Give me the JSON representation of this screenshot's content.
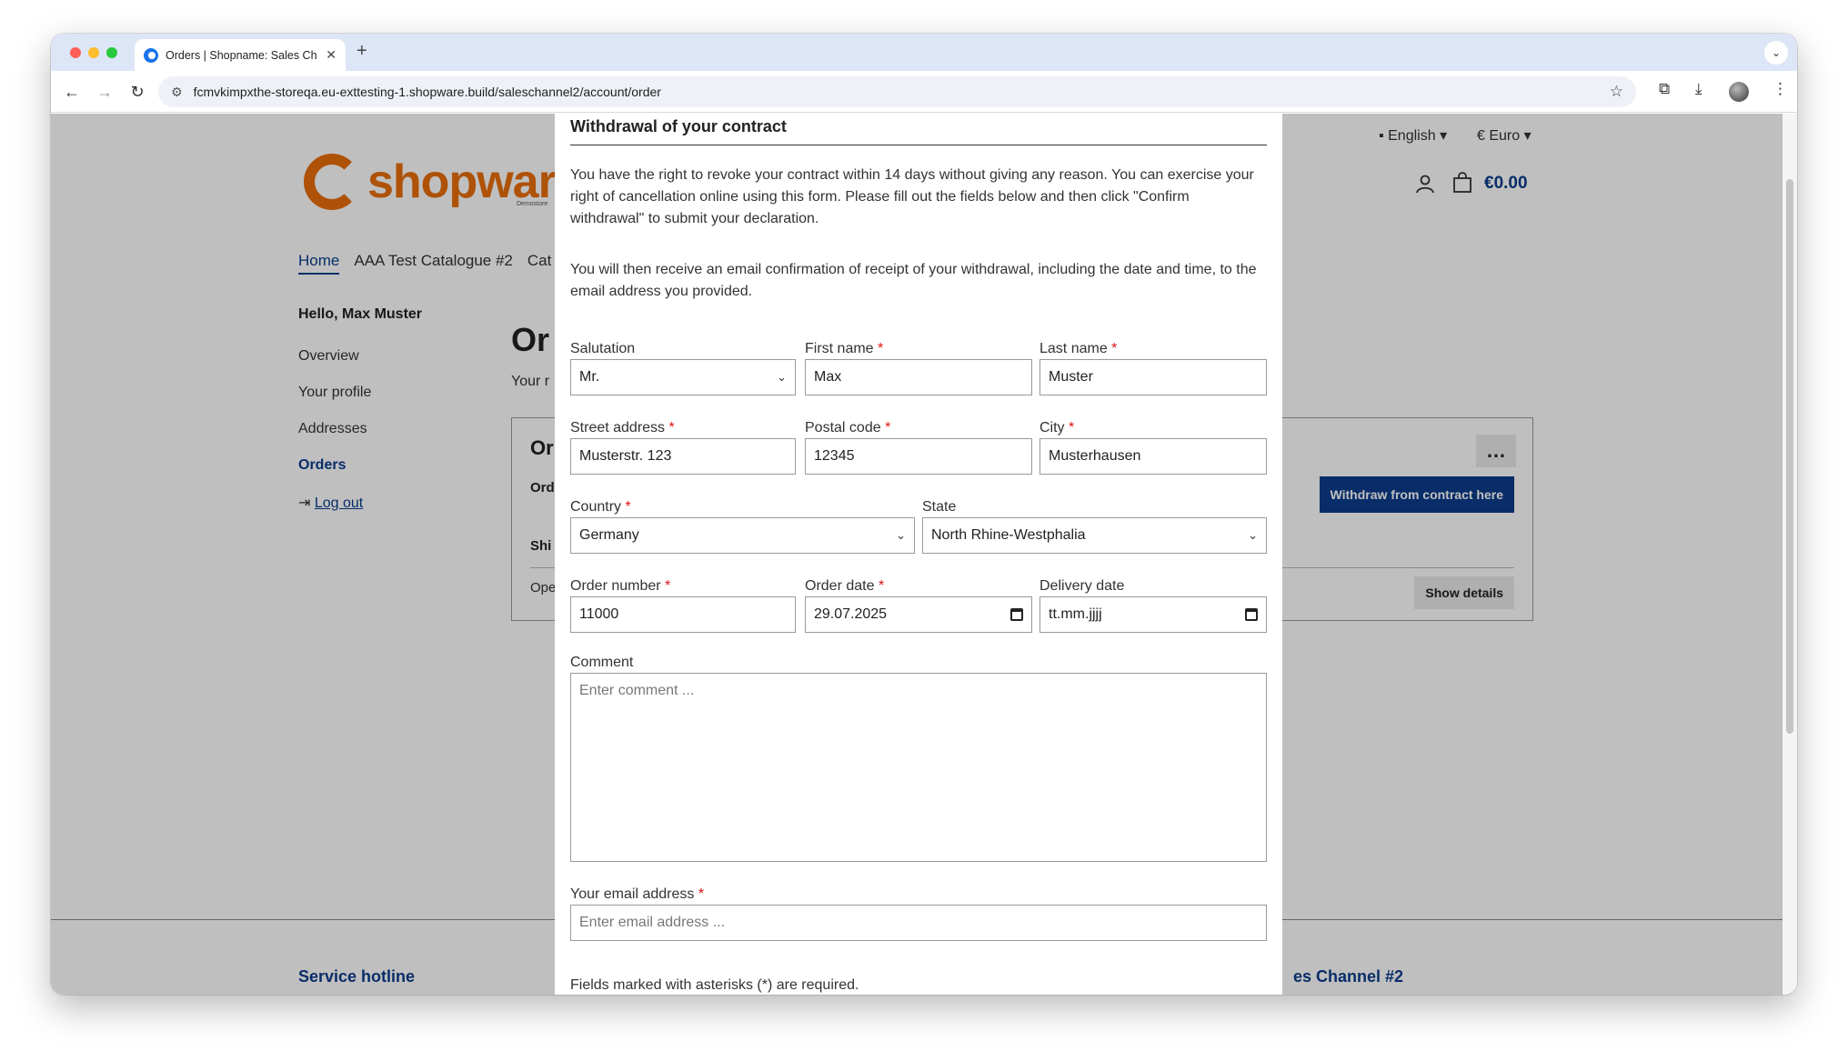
{
  "browser": {
    "tab_title": "Orders | Shopname: Sales Ch",
    "tab_close": "✕",
    "new_tab": "+",
    "tab_menu": "⌄",
    "url": "fcmvkimpxthe-storeqa.eu-exttesting-1.shopware.build/saleschannel2/account/order"
  },
  "header": {
    "logo_text": "shopware",
    "logo_sub": "Demostore",
    "language": "English",
    "currency": "€ Euro",
    "cart_total": "€0.00"
  },
  "main_nav": [
    "Home",
    "AAA Test Catalogue #2",
    "Cat"
  ],
  "account": {
    "greeting": "Hello, Max Muster",
    "nav": [
      "Overview",
      "Your profile",
      "Addresses",
      "Orders",
      "Log out"
    ]
  },
  "orders_page": {
    "heading": "Or",
    "intro": "Your r",
    "card_title": "Or",
    "card_label": "Ord",
    "card_shipping": "Shi",
    "card_status": "Ope",
    "menu_label": "…",
    "withdraw_button": "Withdraw from contract here",
    "details_button": "Show details"
  },
  "footer": {
    "hotline": "Service hotline",
    "channel": "es Channel #2"
  },
  "modal": {
    "title": "Withdrawal of your contract",
    "paragraph1": "You have the right to revoke your contract within 14 days without giving any reason. You can exercise your right of cancellation online using this form. Please fill out the fields below and then click \"Confirm withdrawal\" to submit your declaration.",
    "paragraph2": "You will then receive an email confirmation of receipt of your withdrawal, including the date and time, to the email address you provided.",
    "fields": {
      "salutation": {
        "label": "Salutation",
        "value": "Mr."
      },
      "first_name": {
        "label": "First name",
        "value": "Max"
      },
      "last_name": {
        "label": "Last name",
        "value": "Muster"
      },
      "street": {
        "label": "Street address",
        "value": "Musterstr. 123"
      },
      "postal_code": {
        "label": "Postal code",
        "value": "12345"
      },
      "city": {
        "label": "City",
        "value": "Musterhausen"
      },
      "country": {
        "label": "Country",
        "value": "Germany"
      },
      "state": {
        "label": "State",
        "value": "North Rhine-Westphalia"
      },
      "order_number": {
        "label": "Order number",
        "value": "11000"
      },
      "order_date": {
        "label": "Order date",
        "value": "29.07.2025"
      },
      "delivery_date": {
        "label": "Delivery date",
        "value": "tt.mm.jjjj"
      },
      "comment": {
        "label": "Comment",
        "placeholder": "Enter comment  ..."
      },
      "email": {
        "label": "Your email address",
        "placeholder": "Enter email address ..."
      }
    },
    "required_asterisk": "*",
    "required_note": "Fields marked with asterisks (*) are required."
  },
  "colors": {
    "brand_orange": "#e96e0b",
    "primary_blue": "#0b3c8c",
    "required_red": "#dd1111"
  }
}
